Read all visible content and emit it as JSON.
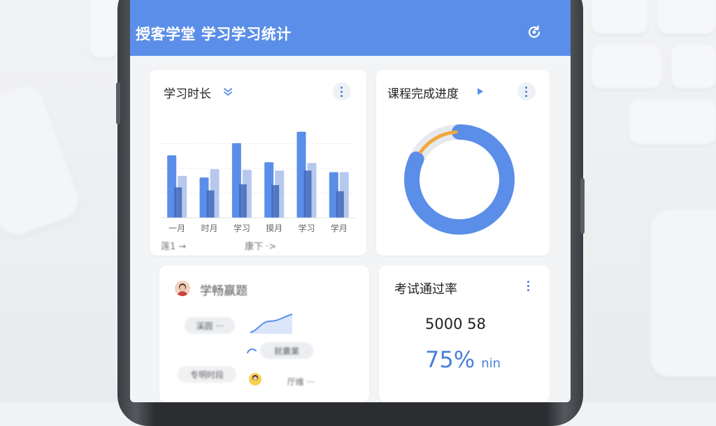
{
  "header": {
    "title": "授客学堂  学习学习统计",
    "icon": "refresh-icon"
  },
  "study_time": {
    "title": "学习时长",
    "icon": "chevron-double-down-icon",
    "footer_left": "莲1 →",
    "footer_right": "康下 ·>"
  },
  "chart_data": {
    "type": "bar",
    "categories": [
      "一月",
      "时月",
      "学习",
      "摸月",
      "学习",
      "学月"
    ],
    "series": [
      {
        "values": [
          82,
          53,
          98,
          73,
          113,
          60
        ]
      },
      {
        "values": [
          55,
          64,
          63,
          62,
          72,
          60
        ]
      },
      {
        "values": [
          40,
          36,
          44,
          43,
          62,
          35
        ]
      }
    ],
    "ylim": [
      0,
      130
    ],
    "grid": true,
    "colors": [
      "#5a8ee8",
      "#b7c8ee",
      "#3f68b8"
    ]
  },
  "progress": {
    "title": "课程完成进度",
    "icon": "play-triangle-icon",
    "value_percent": 82,
    "accent_percent": 14,
    "colors": {
      "main": "#5a8ee8",
      "accent": "#f2a83b",
      "track": "#e6e9ef"
    }
  },
  "activity": {
    "title": "学畅赢题",
    "pill1": "溪圆 ···",
    "pill2": "就囊業",
    "label3": "专明时段",
    "pill4": "厅维 ···"
  },
  "exam": {
    "title": "考试通过率",
    "number": "5000 58",
    "rate": "75%",
    "rate_suffix": "nin",
    "accent": "#4a7fdc"
  }
}
